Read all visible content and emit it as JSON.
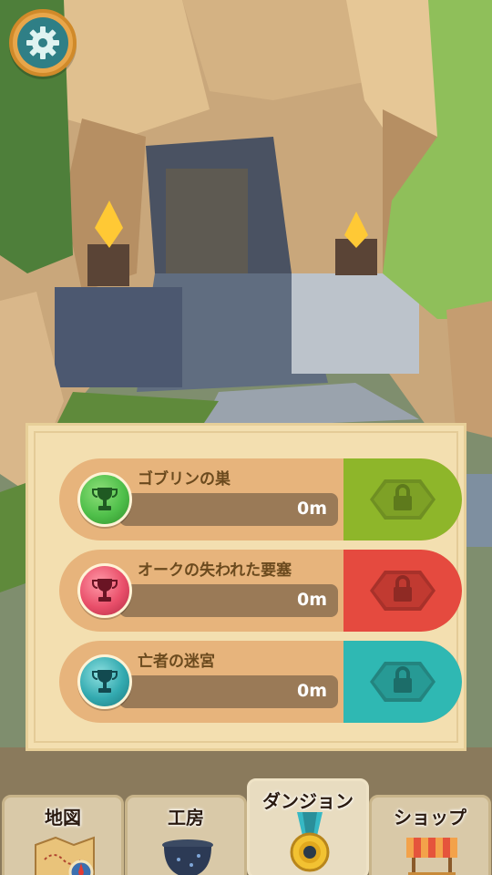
{
  "settings": {
    "icon": "gear-icon"
  },
  "dungeons": [
    {
      "name": "ゴブリンの巣",
      "distance": "0m",
      "trophy_color": "#4fbf4a",
      "lock_color": "#8eb62a",
      "lock_icon": "lock-icon"
    },
    {
      "name": "オークの失われた要塞",
      "distance": "0m",
      "trophy_color": "#e94f6a",
      "lock_color": "#e54a3f",
      "lock_icon": "lock-icon"
    },
    {
      "name": "亡者の迷宮",
      "distance": "0m",
      "trophy_color": "#33aab0",
      "lock_color": "#2fb8b3",
      "lock_icon": "lock-icon"
    }
  ],
  "tabs": [
    {
      "label": "地図",
      "icon": "map-icon",
      "active": false
    },
    {
      "label": "工房",
      "icon": "cauldron-icon",
      "active": false
    },
    {
      "label": "ダンジョン",
      "icon": "medal-icon",
      "active": true
    },
    {
      "label": "ショップ",
      "icon": "shop-stall-icon",
      "active": false
    }
  ]
}
